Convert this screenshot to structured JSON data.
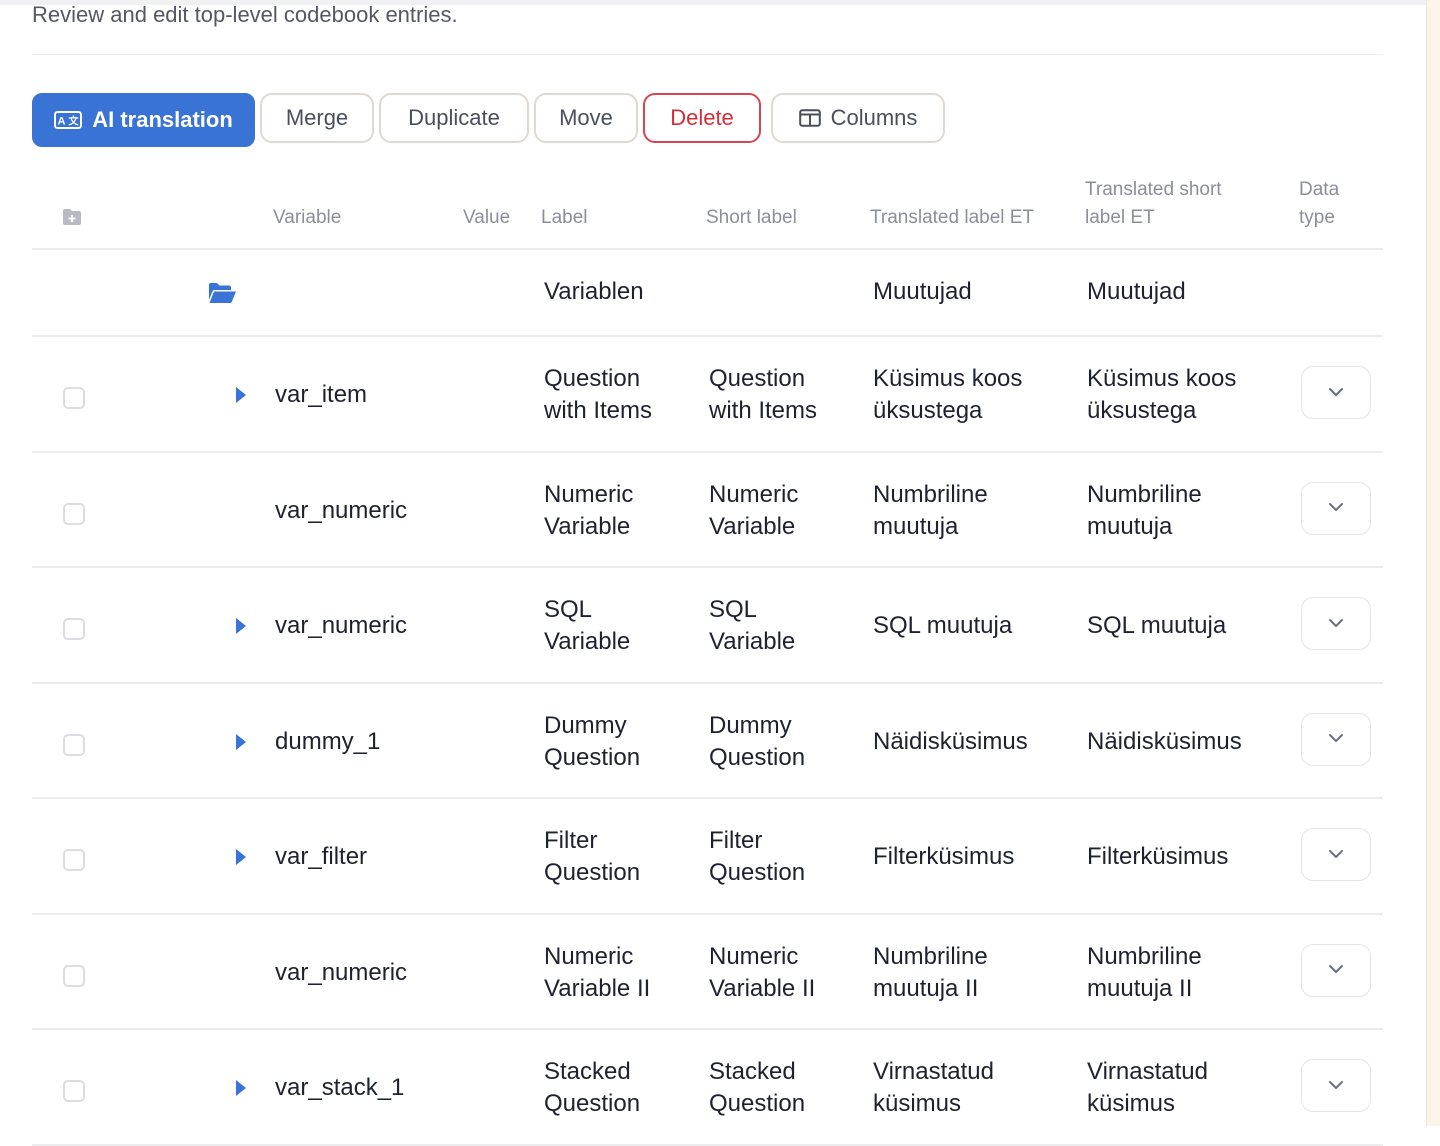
{
  "subtitle": "Review and edit top-level codebook entries.",
  "toolbar": {
    "ai_translation": "AI translation",
    "merge": "Merge",
    "duplicate": "Duplicate",
    "move": "Move",
    "delete": "Delete",
    "columns": "Columns"
  },
  "columns": {
    "variable": "Variable",
    "value": "Value",
    "label": "Label",
    "short_label": "Short label",
    "translated_label": "Translated label ET",
    "translated_short_label_line1": "Translated short",
    "translated_short_label_line2": "label ET",
    "data_type_line1": "Data",
    "data_type_line2": "type"
  },
  "folder_row": {
    "label": "Variablen",
    "translated_label": "Muutujad",
    "translated_short_label": "Muutujad"
  },
  "rows": [
    {
      "variable": "var_item",
      "expandable": true,
      "label_1": "Question",
      "label_2": "with Items",
      "short_1": "Question",
      "short_2": "with Items",
      "tl_1": "Küsimus koos",
      "tl_2": "üksustega",
      "tsl_1": "Küsimus koos",
      "tsl_2": "üksustega"
    },
    {
      "variable": "var_numeric",
      "expandable": false,
      "label_1": "Numeric",
      "label_2": "Variable",
      "short_1": "Numeric",
      "short_2": "Variable",
      "tl_1": "Numbriline",
      "tl_2": "muutuja",
      "tsl_1": "Numbriline",
      "tsl_2": "muutuja"
    },
    {
      "variable": "var_numeric",
      "expandable": true,
      "label_1": "SQL",
      "label_2": "Variable",
      "short_1": "SQL",
      "short_2": "Variable",
      "tl_1": "SQL muutuja",
      "tl_2": "",
      "tsl_1": "SQL muutuja",
      "tsl_2": ""
    },
    {
      "variable": "dummy_1",
      "expandable": true,
      "label_1": "Dummy",
      "label_2": "Question",
      "short_1": "Dummy",
      "short_2": "Question",
      "tl_1": "Näidisküsimus",
      "tl_2": "",
      "tsl_1": "Näidisküsimus",
      "tsl_2": ""
    },
    {
      "variable": "var_filter",
      "expandable": true,
      "label_1": "Filter",
      "label_2": "Question",
      "short_1": "Filter",
      "short_2": "Question",
      "tl_1": "Filterküsimus",
      "tl_2": "",
      "tsl_1": "Filterküsimus",
      "tsl_2": ""
    },
    {
      "variable": "var_numeric",
      "expandable": false,
      "label_1": "Numeric",
      "label_2": "Variable II",
      "short_1": "Numeric",
      "short_2": "Variable II",
      "tl_1": "Numbriline",
      "tl_2": "muutuja II",
      "tsl_1": "Numbriline",
      "tsl_2": "muutuja II"
    },
    {
      "variable": "var_stack_1",
      "expandable": true,
      "label_1": "Stacked",
      "label_2": "Question",
      "short_1": "Stacked",
      "short_2": "Question",
      "tl_1": "Virnastatud",
      "tl_2": "küsimus",
      "tsl_1": "Virnastatud",
      "tsl_2": "küsimus"
    }
  ],
  "icons": {
    "ai_translation": "translate-icon",
    "columns": "columns-icon",
    "header": "folder-plus-icon",
    "folder": "folder-open-icon",
    "expand": "caret-right-icon",
    "dropdown": "chevron-down-icon"
  },
  "colors": {
    "accent": "#3a73d6",
    "danger": "#d62d3a"
  }
}
